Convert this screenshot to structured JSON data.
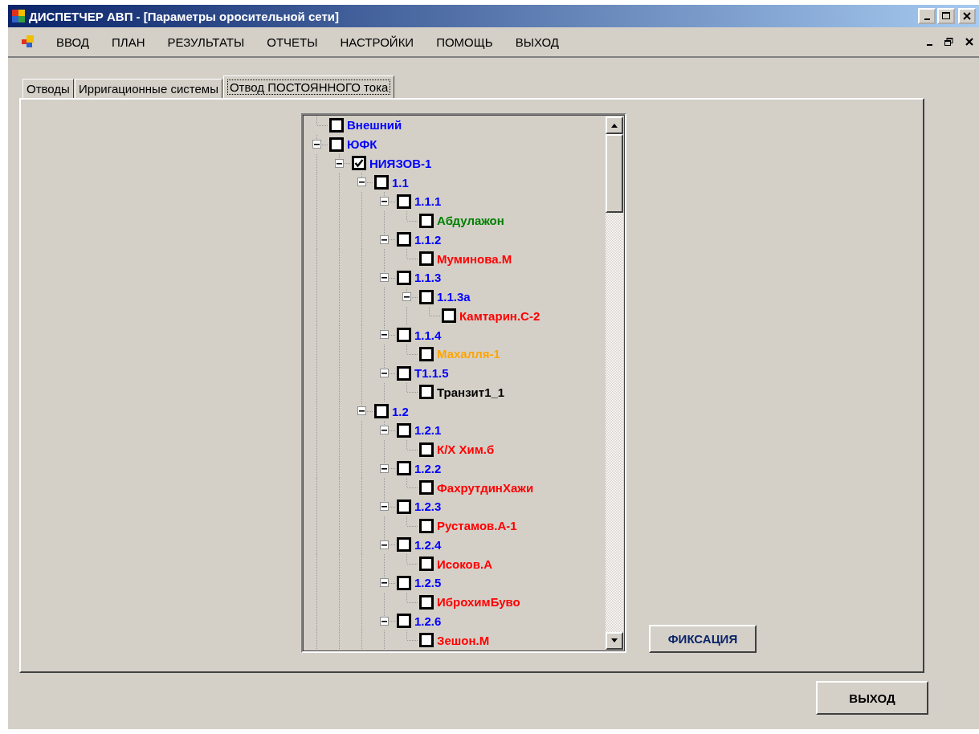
{
  "window": {
    "title": "ДИСПЕТЧЕР АВП - [Параметры оросительной сети]"
  },
  "menu": [
    {
      "label": "ВВОД"
    },
    {
      "label": "ПЛАН"
    },
    {
      "label": "РЕЗУЛЬТАТЫ"
    },
    {
      "label": "ОТЧЕТЫ"
    },
    {
      "label": "НАСТРОЙКИ"
    },
    {
      "label": "ПОМОЩЬ"
    },
    {
      "label": "ВЫХОД"
    }
  ],
  "tabs": [
    {
      "label": "Отводы",
      "selected": false
    },
    {
      "label": "Ирригационные системы",
      "selected": false
    },
    {
      "label": "Отвод ПОСТОЯННОГО тока",
      "selected": true
    }
  ],
  "tree": [
    {
      "label": "Внешний",
      "color": "#0000ff",
      "checked": false
    },
    {
      "label": "ЮФК",
      "color": "#0000ff",
      "checked": false,
      "expanded": true,
      "children": [
        {
          "label": "НИЯЗОВ-1",
          "color": "#0000ff",
          "checked": true,
          "expanded": true,
          "children": [
            {
              "label": "1.1",
              "color": "#0000ff",
              "checked": false,
              "expanded": true,
              "children": [
                {
                  "label": "1.1.1",
                  "color": "#0000ff",
                  "checked": false,
                  "expanded": true,
                  "children": [
                    {
                      "label": "Абдулажон",
                      "color": "#008000",
                      "checked": false
                    }
                  ]
                },
                {
                  "label": "1.1.2",
                  "color": "#0000ff",
                  "checked": false,
                  "expanded": true,
                  "children": [
                    {
                      "label": "Муминова.М",
                      "color": "#ff0000",
                      "checked": false
                    }
                  ]
                },
                {
                  "label": "1.1.3",
                  "color": "#0000ff",
                  "checked": false,
                  "expanded": true,
                  "children": [
                    {
                      "label": "1.1.3а",
                      "color": "#0000ff",
                      "checked": false,
                      "expanded": true,
                      "children": [
                        {
                          "label": "Камтарин.С-2",
                          "color": "#ff0000",
                          "checked": false
                        }
                      ]
                    }
                  ]
                },
                {
                  "label": "1.1.4",
                  "color": "#0000ff",
                  "checked": false,
                  "expanded": true,
                  "children": [
                    {
                      "label": "Махалля-1",
                      "color": "#ffa500",
                      "checked": false
                    }
                  ]
                },
                {
                  "label": "Т1.1.5",
                  "color": "#0000ff",
                  "checked": false,
                  "expanded": true,
                  "children": [
                    {
                      "label": "Транзит1_1",
                      "color": "#000000",
                      "checked": false
                    }
                  ]
                }
              ]
            },
            {
              "label": "1.2",
              "color": "#0000ff",
              "checked": false,
              "expanded": true,
              "children": [
                {
                  "label": "1.2.1",
                  "color": "#0000ff",
                  "checked": false,
                  "expanded": true,
                  "children": [
                    {
                      "label": "К/Х Хим.б",
                      "color": "#ff0000",
                      "checked": false
                    }
                  ]
                },
                {
                  "label": "1.2.2",
                  "color": "#0000ff",
                  "checked": false,
                  "expanded": true,
                  "children": [
                    {
                      "label": "ФахрутдинХажи",
                      "color": "#ff0000",
                      "checked": false
                    }
                  ]
                },
                {
                  "label": "1.2.3",
                  "color": "#0000ff",
                  "checked": false,
                  "expanded": true,
                  "children": [
                    {
                      "label": "Рустамов.А-1",
                      "color": "#ff0000",
                      "checked": false
                    }
                  ]
                },
                {
                  "label": "1.2.4",
                  "color": "#0000ff",
                  "checked": false,
                  "expanded": true,
                  "children": [
                    {
                      "label": "Исоков.А",
                      "color": "#ff0000",
                      "checked": false
                    }
                  ]
                },
                {
                  "label": "1.2.5",
                  "color": "#0000ff",
                  "checked": false,
                  "expanded": true,
                  "children": [
                    {
                      "label": "ИброхимБуво",
                      "color": "#ff0000",
                      "checked": false
                    }
                  ]
                },
                {
                  "label": "1.2.6",
                  "color": "#0000ff",
                  "checked": false,
                  "expanded": true,
                  "children": [
                    {
                      "label": "Зешон.М",
                      "color": "#ff0000",
                      "checked": false
                    }
                  ]
                }
              ]
            }
          ]
        }
      ]
    }
  ],
  "fix_button": "ФИКСАЦИЯ",
  "exit_button": "ВЫХОД"
}
